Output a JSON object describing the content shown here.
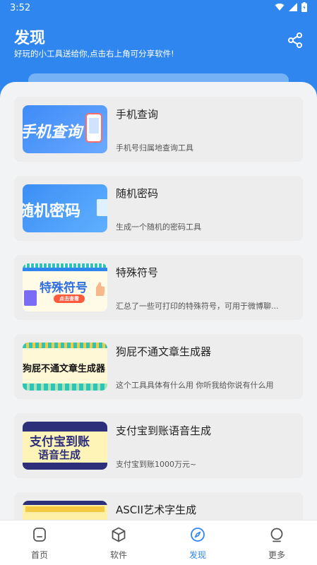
{
  "status_bar": {
    "time": "3:52"
  },
  "header": {
    "title": "发现",
    "subtitle": "好玩的小工具送给你,点击右上角可分享软件!"
  },
  "tools": [
    {
      "title": "手机查询",
      "description": "手机号归属地查询工具",
      "thumb_text": "手机查询"
    },
    {
      "title": "随机密码",
      "description": "生成一个随机的密码工具",
      "thumb_text": "随机密码"
    },
    {
      "title": "特殊符号",
      "description": "汇总了一些可打印的特殊符号，可用于微博聊...",
      "thumb_text": "特殊符号",
      "thumb_subtext": "点击查看"
    },
    {
      "title": "狗屁不通文章生成器",
      "description": "这个工具具体有什么用 你听我给你说有什么用",
      "thumb_text": "狗屁不通文章生成器"
    },
    {
      "title": "支付宝到账语音生成",
      "description": "支付宝到账1000万元~",
      "thumb_text": "支付宝到账",
      "thumb_text2": "语音生成"
    },
    {
      "title": "ASCII艺术字生成",
      "description": "",
      "thumb_text": ""
    }
  ],
  "nav": [
    {
      "label": "首页",
      "icon": "home-icon"
    },
    {
      "label": "软件",
      "icon": "box-icon"
    },
    {
      "label": "发现",
      "icon": "compass-icon",
      "active": true
    },
    {
      "label": "更多",
      "icon": "more-icon"
    }
  ],
  "colors": {
    "primary": "#2f86ef",
    "card_bg": "#ededed"
  }
}
